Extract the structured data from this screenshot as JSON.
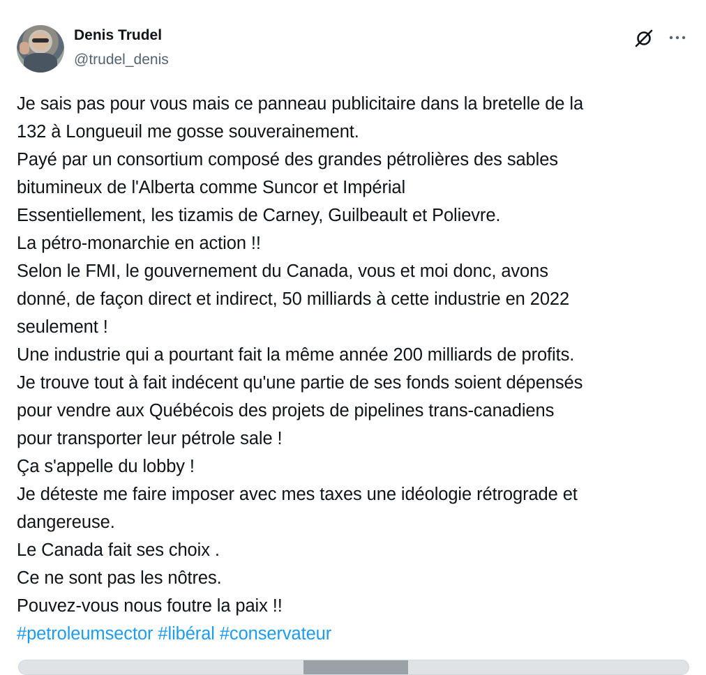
{
  "author": {
    "display_name": "Denis Trudel",
    "handle": "@trudel_denis"
  },
  "actions": {
    "grok_icon": "grok-icon",
    "more_icon": "more-options-icon"
  },
  "tweet": {
    "lines": [
      "Je sais pas pour vous mais ce panneau publicitaire dans la bretelle de la",
      "132 à Longueuil me gosse souverainement.",
      "Payé par un consortium composé des grandes  pétrolières des sables",
      "bitumineux de l'Alberta comme Suncor et Impérial",
      "Essentiellement, les tizamis de Carney, Guilbeault et Polievre.",
      "La pétro-monarchie en action !!",
      "Selon le FMI, le gouvernement du Canada, vous et moi donc, avons",
      "donné, de façon direct et indirect, 50 milliards à cette industrie en 2022",
      "seulement !",
      "Une industrie qui a pourtant fait la même année 200 milliards de profits.",
      "Je trouve tout à fait indécent qu'une partie de ses fonds soient dépensés",
      "pour vendre aux Québécois des projets de pipelines trans-canadiens",
      "pour transporter leur pétrole sale !",
      "Ça s'appelle du lobby !",
      "Je déteste me faire imposer avec mes taxes une idéologie rétrograde et",
      "dangereuse.",
      "Le Canada fait ses choix .",
      "Ce ne sont pas les nôtres.",
      "Pouvez-vous nous foutre la paix !!"
    ],
    "hashtags": [
      "#petroleumsector",
      "#libéral",
      "#conservateur"
    ]
  },
  "colors": {
    "text": "#0f1419",
    "secondary": "#536471",
    "link": "#1d9bf0"
  }
}
